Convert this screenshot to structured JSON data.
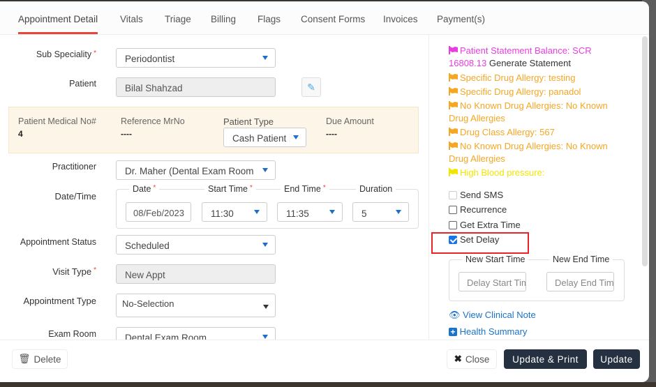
{
  "tabs": [
    "Appointment Detail",
    "Vitals",
    "Triage",
    "Billing",
    "Flags",
    "Consent Forms",
    "Invoices",
    "Payment(s)"
  ],
  "form": {
    "sub_speciality_label": "Sub Speciality",
    "sub_speciality": "Periodontist",
    "patient_label": "Patient",
    "patient": "Bilal Shahzad",
    "medical_no_label": "Patient Medical No#",
    "medical_no": "4",
    "ref_label": "Reference MrNo",
    "ref": "----",
    "patient_type_label": "Patient Type",
    "patient_type": "Cash Patient",
    "due_label": "Due Amount",
    "due": "----",
    "practitioner_label": "Practitioner",
    "practitioner": "Dr. Maher (Dental Exam Room",
    "datetime_label": "Date/Time",
    "date_label": "Date",
    "date": "08/Feb/2023",
    "start_label": "Start Time",
    "start": "11:30",
    "end_label": "End Time",
    "end": "11:35",
    "duration_label": "Duration",
    "duration": "5",
    "status_label": "Appointment Status",
    "status": "Scheduled",
    "visit_label": "Visit Type",
    "visit": "New Appt",
    "appt_type_label": "Appointment Type",
    "appt_type": "No-Selection",
    "exam_label": "Exam Room",
    "exam": "Dental Exam Room",
    "required_mark": "*"
  },
  "flags": {
    "balance": "Patient Statement Balance: SCR 16808.13",
    "generate": "Generate Statement",
    "items": [
      "Specific Drug Allergy: testing",
      "Specific Drug Allergy: panadol",
      "No Known Drug Allergies: No Known Drug Allergies",
      "Drug Class Allergy: 567",
      "No Known Drug Allergies: No Known Drug Allergies"
    ],
    "bp": "High Blood pressure:",
    "colors": {
      "balance": "#e83ee0",
      "allergy": "#f5a623",
      "bp": "#f2e600"
    }
  },
  "options": {
    "send_sms": "Send SMS",
    "recurrence": "Recurrence",
    "extra_time": "Get Extra Time",
    "set_delay": "Set Delay"
  },
  "delay": {
    "start_label": "New Start Time",
    "end_label": "New End Time",
    "start_placeholder": "Delay Start Time",
    "end_placeholder": "Delay End Time"
  },
  "links": {
    "clinical_note": "View Clinical Note",
    "health_summary": "Health Summary"
  },
  "buttons": {
    "delete": "Delete",
    "close": "Close",
    "update_print": "Update & Print",
    "update": "Update"
  }
}
